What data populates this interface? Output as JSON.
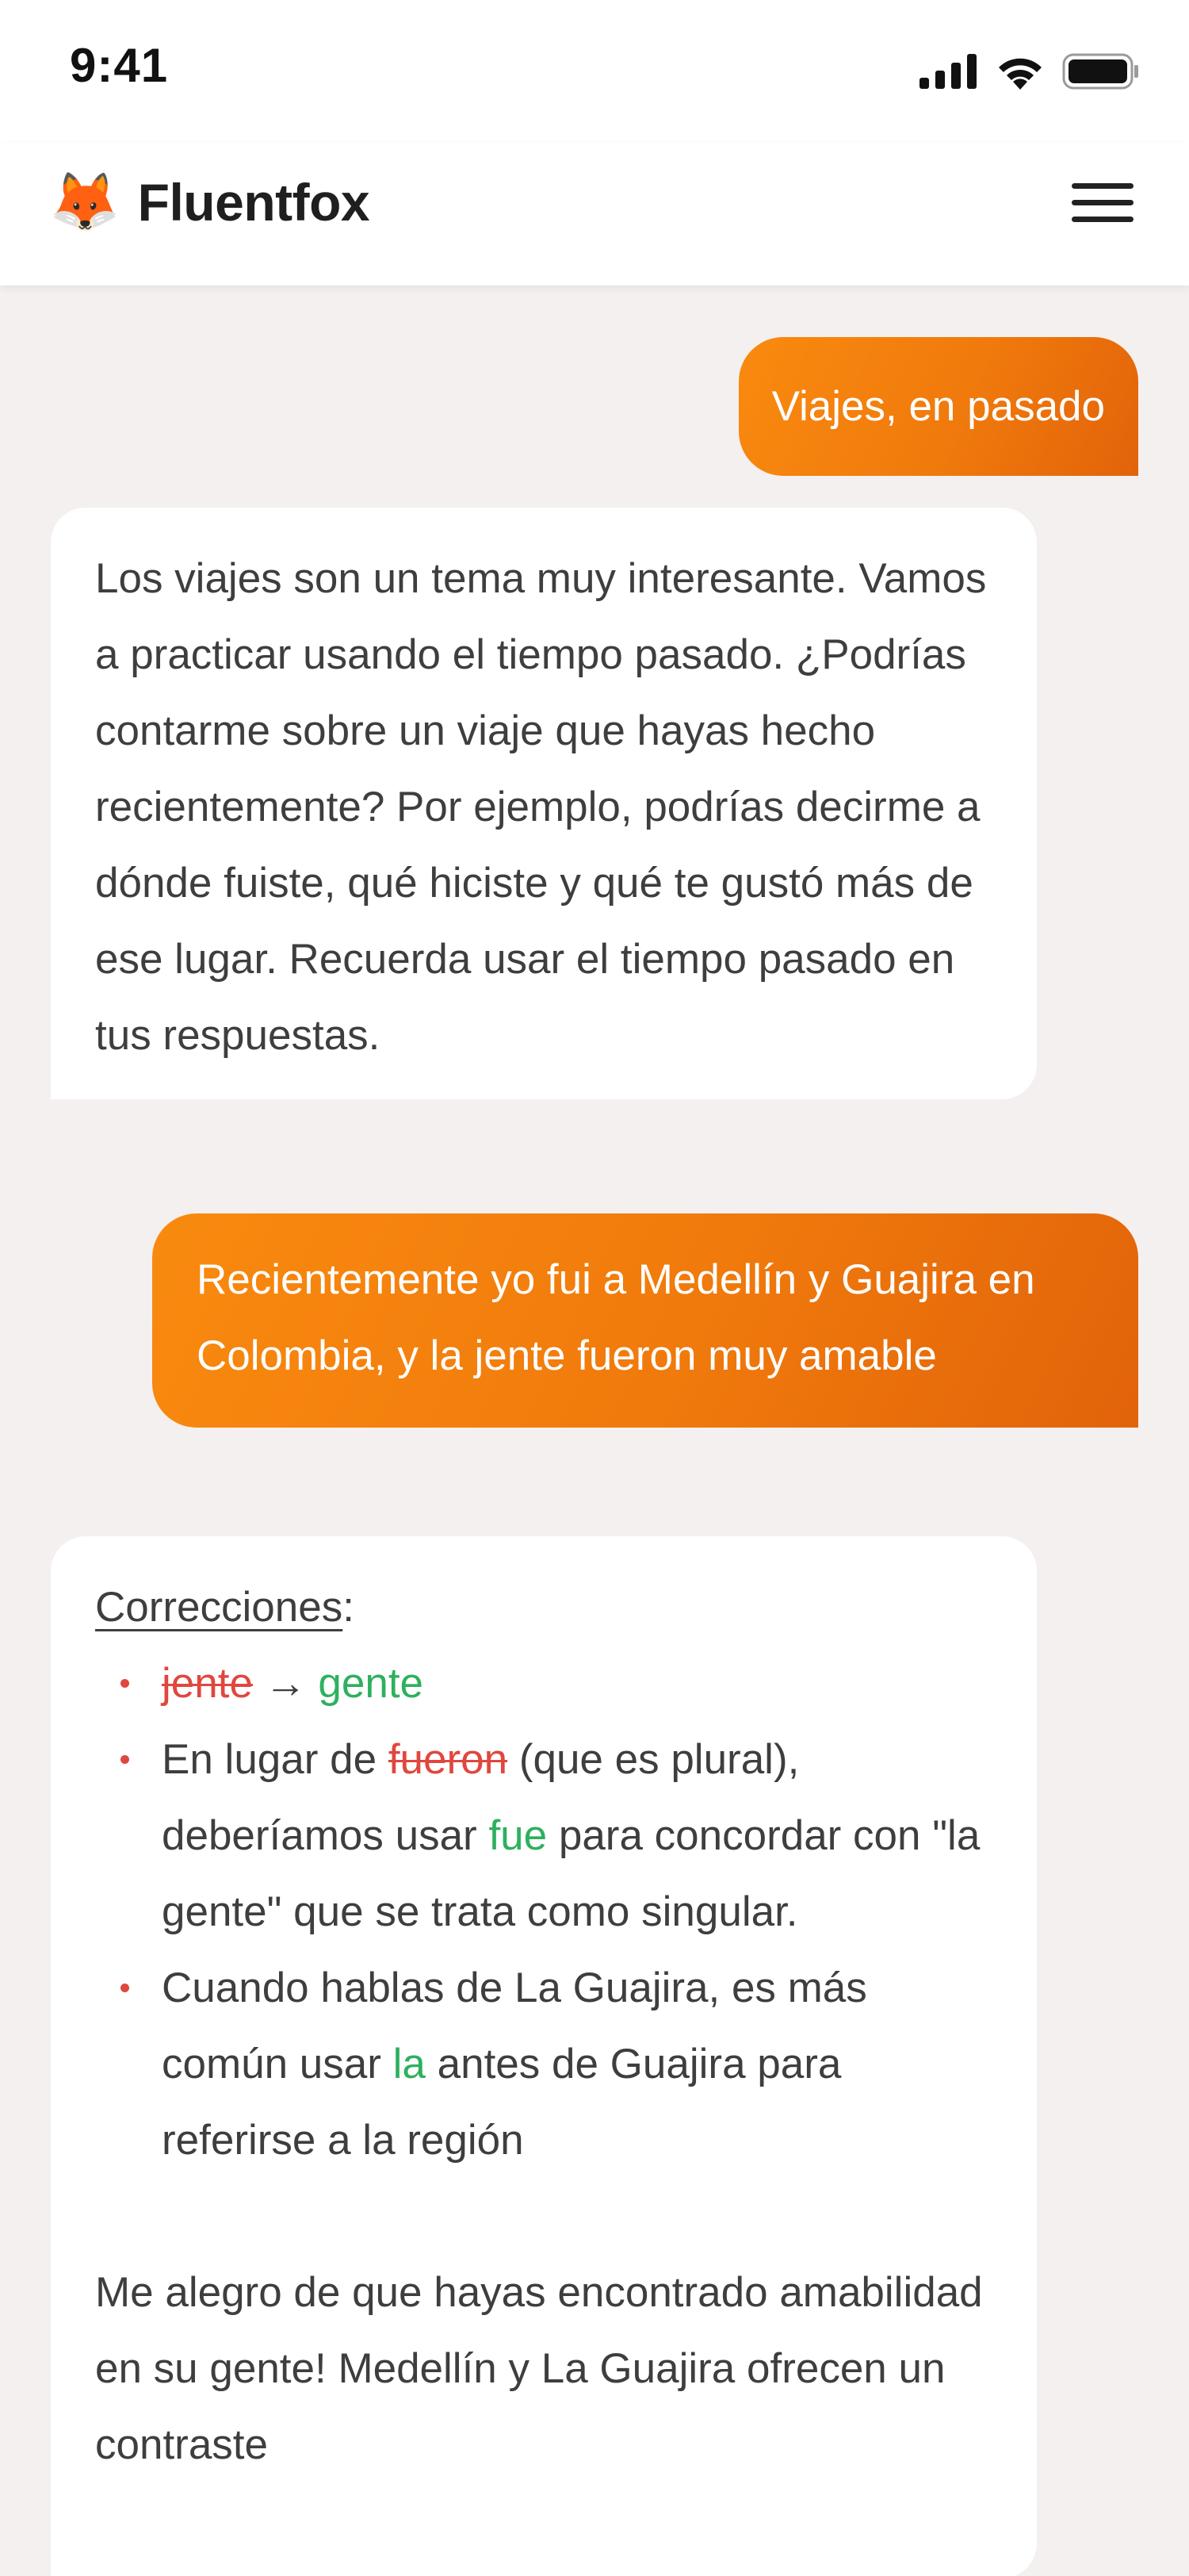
{
  "status_bar": {
    "time": "9:41",
    "icons": [
      "signal-icon",
      "wifi-icon",
      "battery-icon"
    ]
  },
  "header": {
    "logo_emoji": "🦊",
    "app_name": "Fluentfox",
    "menu_icon": "hamburger-menu-icon"
  },
  "colors": {
    "accent_start": "#f98a0f",
    "accent_end": "#e2630a",
    "error": "#e0473f",
    "success": "#2eb05e",
    "background": "#f3f0ef"
  },
  "messages": [
    {
      "role": "user",
      "text": "Viajes, en pasado"
    },
    {
      "role": "assistant",
      "text": "Los viajes son un tema muy interesante. Vamos a practicar usando el tiempo pasado. ¿Podrías contarme sobre un viaje que hayas hecho recientemente? Por ejemplo, podrías decirme a dónde fuiste, qué hiciste y qué te gustó más de ese lugar. Recuerda usar el tiempo pasado en tus respuestas."
    },
    {
      "role": "user",
      "text": "Recientemente yo fui a Medellín y Guajira en Colombia,  y la jente fueron muy amable"
    }
  ],
  "corrections": {
    "title": "Correcciones",
    "title_suffix": ":",
    "items": [
      {
        "wrong": "jente",
        "arrow": "→",
        "right": "gente"
      },
      {
        "before": "En lugar de ",
        "wrong": "fueron",
        "middle": " (que es plural), deberíamos usar ",
        "right": "fue",
        "after": " para concordar con \"la gente\" que se trata como singular."
      },
      {
        "before": "Cuando hablas de La Guajira, es más común usar ",
        "right": "la",
        "after": " antes de Guajira para referirse a la región"
      }
    ],
    "followup": "Me alegro de que hayas encontrado amabilidad en su gente! Medellín y La Guajira ofrecen un contraste"
  }
}
